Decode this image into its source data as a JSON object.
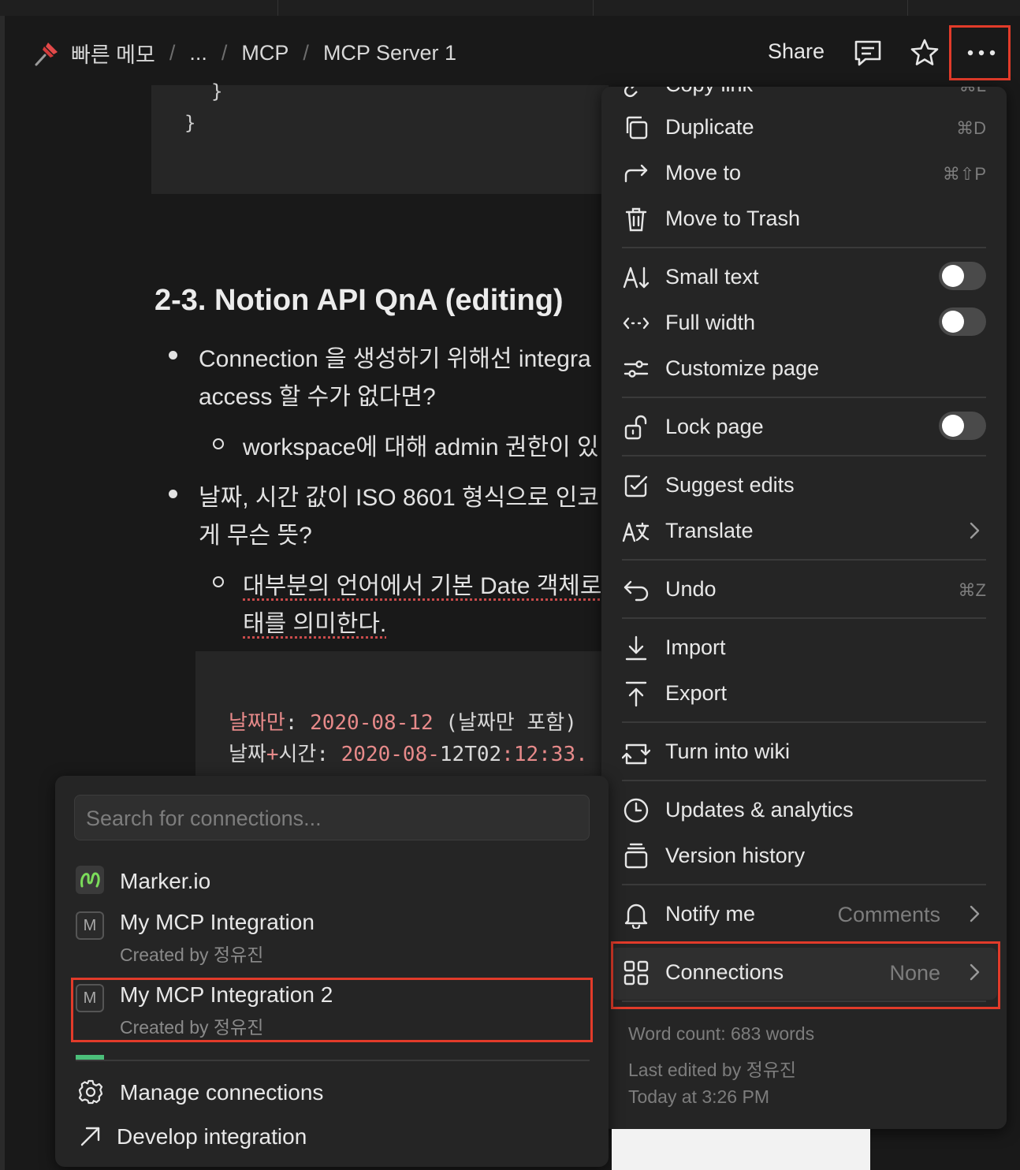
{
  "breadcrumb": {
    "items": [
      "빠른 메모",
      "...",
      "MCP",
      "MCP Server 1"
    ],
    "separator": "/"
  },
  "header": {
    "share_label": "Share"
  },
  "content": {
    "code_top": [
      "}",
      "}"
    ],
    "heading": "2-3. Notion API QnA (editing)",
    "bullets": [
      {
        "line1": "Connection 을 생성하기 위해선 integra",
        "line2": "access 할 수가 없다면?"
      },
      {
        "line1": "날짜, 시간 값이 ISO 8601 형식으로 인코",
        "line2": "게 무슨 뜻?"
      }
    ],
    "sub_bullets": [
      {
        "line1": "workspace에 대해 admin 권한이 있"
      },
      {
        "line1": "대부분의 언어에서 기본 Date 객체로",
        "line2": "태를 의미한다."
      }
    ],
    "code_mid": {
      "row1": {
        "key": "날짜만",
        "colon": ":",
        "value": "2020-08-12",
        "note": "(날짜만 포함)"
      },
      "row2": {
        "key_a": "날짜",
        "plus": "+",
        "key_b": "시간",
        "colon": ":",
        "value_a": "2020-08-",
        "value_b": "12T02",
        "value_c": ":12:33."
      }
    }
  },
  "menu": {
    "copy_link": {
      "label": "Copy link",
      "shortcut": "⌘L"
    },
    "duplicate": {
      "label": "Duplicate",
      "shortcut": "⌘D"
    },
    "move_to": {
      "label": "Move to",
      "shortcut": "⌘⇧P"
    },
    "move_to_trash": {
      "label": "Move to Trash"
    },
    "small_text": {
      "label": "Small text",
      "checked": false
    },
    "full_width": {
      "label": "Full width",
      "checked": false
    },
    "customize_page": {
      "label": "Customize page"
    },
    "lock_page": {
      "label": "Lock page",
      "checked": false
    },
    "suggest_edits": {
      "label": "Suggest edits"
    },
    "translate": {
      "label": "Translate"
    },
    "undo": {
      "label": "Undo",
      "shortcut": "⌘Z"
    },
    "import": {
      "label": "Import"
    },
    "export": {
      "label": "Export"
    },
    "turn_into_wiki": {
      "label": "Turn into wiki"
    },
    "updates_analytics": {
      "label": "Updates & analytics"
    },
    "version_history": {
      "label": "Version history"
    },
    "notify_me": {
      "label": "Notify me",
      "value": "Comments"
    },
    "connections": {
      "label": "Connections",
      "value": "None"
    },
    "word_count": "Word count: 683 words",
    "last_edited_by": "Last edited by 정유진",
    "last_edited_at": "Today at 3:26 PM"
  },
  "connections_submenu": {
    "search_placeholder": "Search for connections...",
    "items": [
      {
        "name": "Marker.io",
        "logo": "marker-io-logo"
      },
      {
        "name": "My MCP Integration",
        "created_by": "Created by 정유진",
        "logo_letter": "M"
      },
      {
        "name": "My MCP Integration 2",
        "created_by": "Created by 정유진",
        "logo_letter": "M"
      }
    ],
    "manage_label": "Manage connections",
    "develop_label": "Develop integration"
  },
  "colors": {
    "background": "#191919",
    "menu_bg": "#252525",
    "highlight_border": "#e23b2a",
    "code_key": "#e78a8a",
    "marker_green": "#7bdc5a"
  }
}
